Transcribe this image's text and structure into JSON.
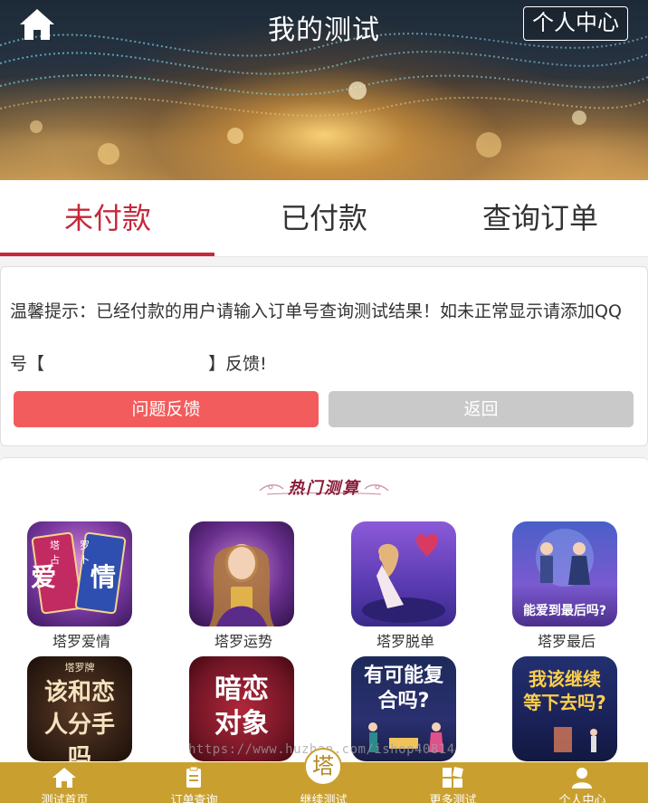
{
  "header": {
    "title": "我的测试",
    "personal_center": "个人中心"
  },
  "tabs": [
    {
      "label": "未付款",
      "active": true
    },
    {
      "label": "已付款",
      "active": false
    },
    {
      "label": "查询订单",
      "active": false
    }
  ],
  "notice": {
    "line1": "温馨提示：已经付款的用户请输入订单号查询测试结果！如未正常显示请添加QQ",
    "line2": "号【                              】反馈!",
    "feedback_button": "问题反馈",
    "back_button": "返回"
  },
  "hot": {
    "title": "热门测算",
    "items": [
      {
        "label": "塔罗爱情",
        "art": "爱 情",
        "sub": "塔罗 占卜"
      },
      {
        "label": "塔罗运势",
        "art": "",
        "sub": ""
      },
      {
        "label": "塔罗脱单",
        "art": "",
        "sub": ""
      },
      {
        "label": "塔罗最后",
        "art": "能爱到最后吗?",
        "sub": ""
      },
      {
        "label": "",
        "art": "该和恋人分手吗",
        "sub": "塔罗牌"
      },
      {
        "label": "",
        "art": "暗恋对象",
        "sub": ""
      },
      {
        "label": "",
        "art": "有可能复合吗?",
        "sub": ""
      },
      {
        "label": "",
        "art": "我该继续等下去吗?",
        "sub": ""
      }
    ]
  },
  "watermark": "https://www.huzhan.com/ishop40814",
  "bottom_nav": {
    "items": [
      {
        "label": "测试首页",
        "icon": "home-icon"
      },
      {
        "label": "订单查询",
        "icon": "clipboard-icon"
      },
      {
        "label": "继续测试",
        "icon": "tower-badge"
      },
      {
        "label": "更多测试",
        "icon": "grid-icon"
      },
      {
        "label": "个人中心",
        "icon": "user-icon"
      }
    ],
    "center_badge": "塔"
  },
  "colors": {
    "accent": "#c7283b",
    "feedback": "#f25c5c",
    "back": "#c9c9c9",
    "nav_bg": "#c9a030"
  }
}
